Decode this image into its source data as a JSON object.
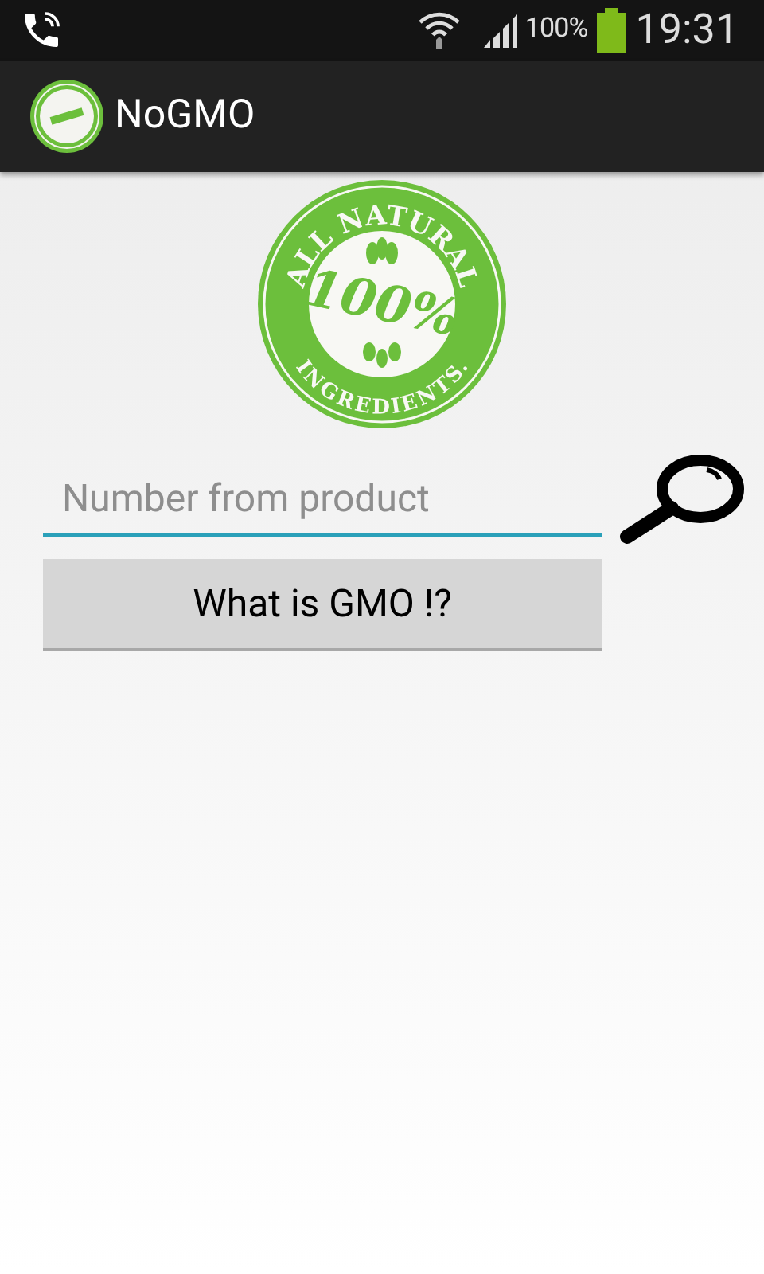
{
  "status_bar": {
    "battery": "100%",
    "time": "19:31"
  },
  "app_bar": {
    "title": "NoGMO"
  },
  "logo": {
    "top_text": "ALL NATURAL",
    "center_text": "100%",
    "bottom_text": "INGREDIENTS."
  },
  "search": {
    "placeholder": "Number from product"
  },
  "button": {
    "label": "What is GMO !?"
  }
}
